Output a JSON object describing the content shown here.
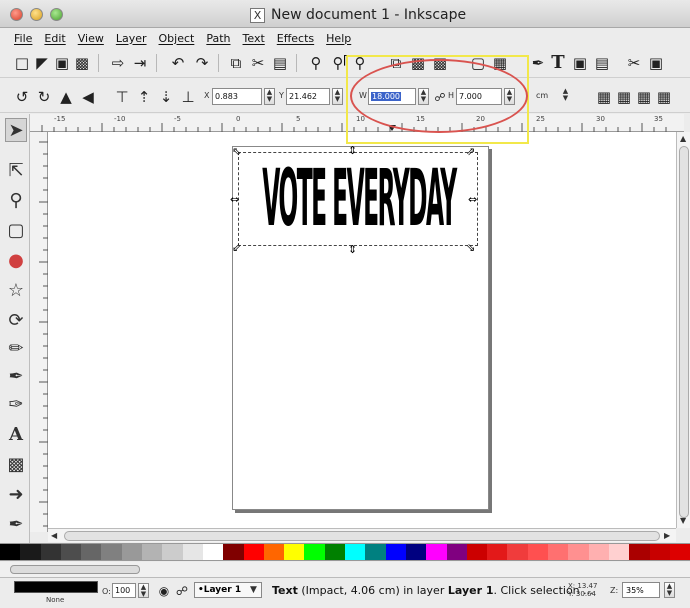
{
  "window": {
    "title": "New document 1 - Inkscape"
  },
  "menu": [
    "File",
    "Edit",
    "View",
    "Layer",
    "Object",
    "Path",
    "Text",
    "Effects",
    "Help"
  ],
  "controls": {
    "x_label": "X",
    "x_value": "0.883",
    "y_label": "Y",
    "y_value": "21.462",
    "w_label": "W",
    "w_value": "18.000",
    "h_label": "H",
    "h_value": "7.000",
    "unit": "cm"
  },
  "canvas": {
    "text": "VOTE EVERYDAY"
  },
  "ruler_numbers": [
    "-15",
    "-10",
    "-5",
    "0",
    "5",
    "10",
    "15",
    "20",
    "25",
    "30",
    "35"
  ],
  "status": {
    "fill_label": "None",
    "opacity": "100",
    "layer": "•Layer 1",
    "message_prefix": "Text",
    "message_detail": "(Impact, 4.06 cm) in layer",
    "message_layer": "Layer 1",
    "message_suffix": ". Click selection ...",
    "x_coord": "X: 13.47",
    "y_coord": "Y: 30.64",
    "zoom_label": "Z:",
    "zoom": "35%"
  },
  "palette": [
    "#000000",
    "#1a1a1a",
    "#333333",
    "#4d4d4d",
    "#666666",
    "#808080",
    "#999999",
    "#b3b3b3",
    "#cccccc",
    "#e6e6e6",
    "#ffffff",
    "#800000",
    "#ff0000",
    "#ff6600",
    "#ffff00",
    "#00ff00",
    "#008000",
    "#00ffff",
    "#008080",
    "#0000ff",
    "#000080",
    "#ff00ff",
    "#800080",
    "#cc0000",
    "#e31919",
    "#f03c3c",
    "#ff5050",
    "#ff7070",
    "#ff9090",
    "#ffb0b0",
    "#ffd0d0",
    "#aa0000",
    "#c80000",
    "#dd0000"
  ]
}
